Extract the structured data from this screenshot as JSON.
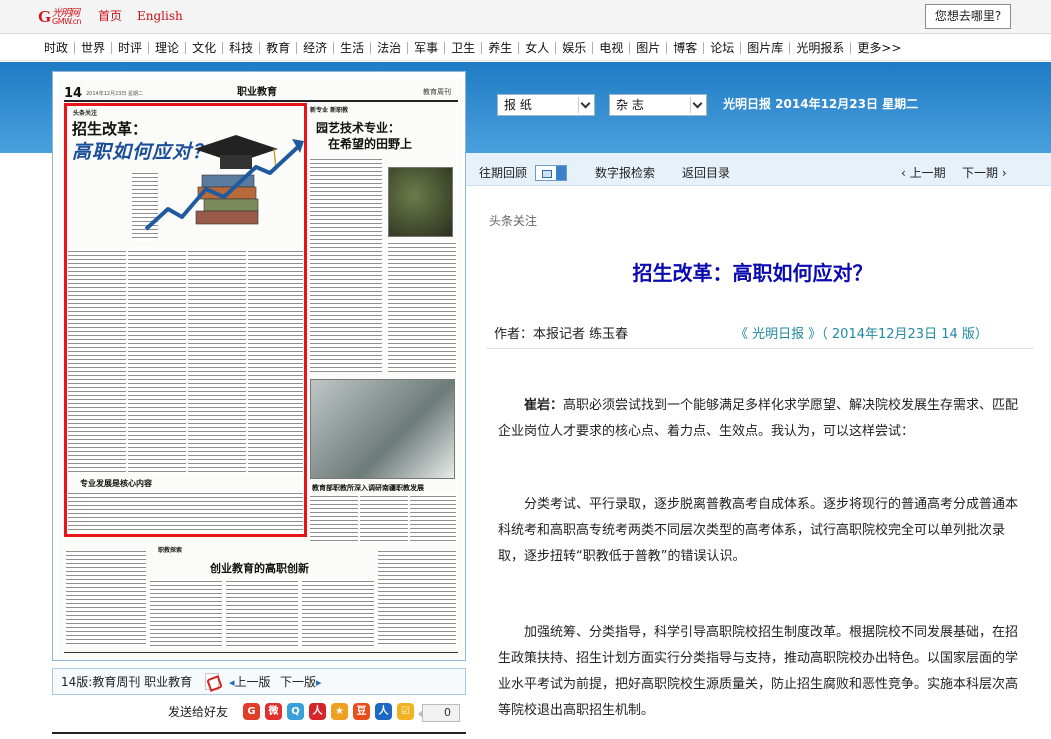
{
  "top": {
    "logo": {
      "glyph": "G",
      "cn": "光明网",
      "en": "GMW.cn"
    },
    "home_label": "首页",
    "english_label": "English",
    "where_button": "您想去哪里?"
  },
  "nav": {
    "items": [
      "时政",
      "世界",
      "时评",
      "理论",
      "文化",
      "科技",
      "教育",
      "经济",
      "生活",
      "法治",
      "军事",
      "卫生",
      "养生",
      "女人",
      "娱乐",
      "电视",
      "图片",
      "博客",
      "论坛",
      "图片库",
      "光明报系",
      "更多>>"
    ]
  },
  "selectors": {
    "paper": "报 纸",
    "magazine": "杂 志",
    "date_line": "光明日报  2014年12月23日  星期二"
  },
  "toolbar": {
    "past": "往期回顾",
    "search": "数字报检索",
    "toc": "返回目录",
    "prev": "上一期",
    "next": "下一期",
    "prev_arrow": "‹",
    "next_arrow": "›"
  },
  "newspaper": {
    "page_num": "14",
    "page_date": "2014年12月23日  星期二",
    "section": "职业教育",
    "weekly": "教育周刊",
    "art_tag": "头条关注",
    "art_h1": "招生改革：",
    "art_h2": "高职如何应对？",
    "art_footer": "专业发展是核心内容",
    "r_tag": "新专业  新职教",
    "r_h1": "园艺技术专业：",
    "r_h2": "在希望的田野上",
    "r_bottom": "教育部职教所深入调研南疆职教发展",
    "b_tag": "职教探索",
    "b_h1": "创业教育的高职创新"
  },
  "left_nav": {
    "issue": "14版:教育周刊 职业教育",
    "prev_edition": "上一版",
    "next_edition": "下一版",
    "prev_arrow": "◂",
    "next_arrow": "▸"
  },
  "share": {
    "label": "发送给好友",
    "count": "0",
    "icons": [
      {
        "name": "qq-space-icon",
        "color": "#e23c2a",
        "glyph": "G"
      },
      {
        "name": "weibo-icon",
        "color": "#e0302c",
        "glyph": "微"
      },
      {
        "name": "tencent-weibo-icon",
        "color": "#3aa0d8",
        "glyph": "Q"
      },
      {
        "name": "renren-icon",
        "color": "#d4262a",
        "glyph": "人"
      },
      {
        "name": "kaixin-icon",
        "color": "#f0a020",
        "glyph": "★"
      },
      {
        "name": "douban-icon",
        "color": "#e84e1b",
        "glyph": "豆"
      },
      {
        "name": "people-icon",
        "color": "#1d68c4",
        "glyph": "人"
      },
      {
        "name": "qzone-icon",
        "color": "#f0b21f",
        "glyph": "☑"
      }
    ]
  },
  "article": {
    "section_label": "头条关注",
    "title": "招生改革：高职如何应对？",
    "author": "作者：本报记者  练玉春",
    "source": "《 光明日报 》（ 2014年12月23日    14 版）",
    "p1_lead": "崔岩：",
    "p1": "高职必须尝试找到一个能够满足多样化求学愿望、解决院校发展生存需求、匹配企业岗位人才要求的核心点、着力点、生效点。我认为，可以这样尝试：",
    "p2": "分类考试、平行录取，逐步脱离普教高考自成体系。逐步将现行的普通高考分成普通本科统考和高职高专统考两类不同层次类型的高考体系，试行高职院校完全可以单列批次录取，逐步扭转“职教低于普教”的错误认识。",
    "p3": "加强统筹、分类指导，科学引导高职院校招生制度改革。根据院校不同发展基础，在招生政策扶持、招生计划方面实行分类指导与支持，推动高职院校办出特色。以国家层面的学业水平考试为前提，把好高职院校生源质量关，防止招生腐败和恶性竞争。实施本科层次高等院校退出高职招生机制。"
  },
  "colors": {
    "brand_red": "#d0141a",
    "band_blue": "#1f7bc4",
    "title_blue": "#0a0ab0",
    "source_teal": "#1f8aa0",
    "highlight_red": "#e8141a"
  }
}
